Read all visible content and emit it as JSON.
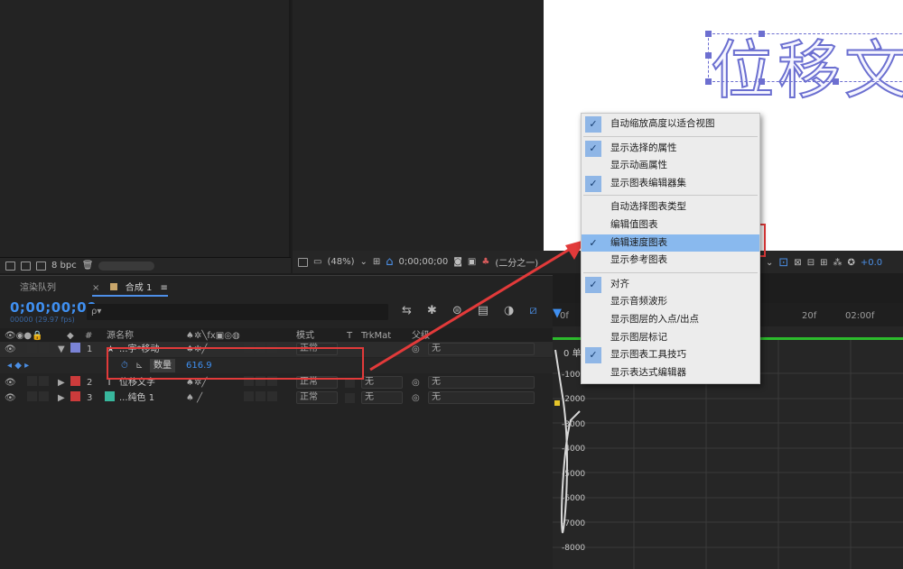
{
  "composition": {
    "title": "位移文字"
  },
  "footer_left": {
    "bpc": "8 bpc"
  },
  "viewer_toolbar": {
    "zoom": "(48%)",
    "timecode": "0;00;00;00",
    "view_mode": "(二分之一)",
    "exposure": "+0.0"
  },
  "panel": {
    "tabs": [
      {
        "label": "渲染队列",
        "close": "×"
      },
      {
        "label": "合成 1",
        "menu": "≡"
      }
    ]
  },
  "timeline": {
    "timecode": "0;00;00;00",
    "fps": "00000 (29.97 fps)",
    "search_placeholder": "ρ▾",
    "columns": {
      "num": "#",
      "source": "源名称",
      "mode": "模式",
      "t": "T",
      "trkmat": "TrkMat",
      "parent": "父级"
    },
    "layers": [
      {
        "num": "1",
        "name": "...字*移动",
        "mode": "正常",
        "trkmat": "",
        "parent": "无",
        "color": "#7a83d6"
      },
      {
        "num": "2",
        "name": "位移文字",
        "mode": "正常",
        "trkmat": "无",
        "parent": "无",
        "color": "#cc3b3b"
      },
      {
        "num": "3",
        "name": "...纯色 1",
        "mode": "正常",
        "trkmat": "无",
        "parent": "无",
        "color": "#cc3b3b"
      }
    ],
    "property": {
      "name": "数量",
      "value": "616.9"
    }
  },
  "graph": {
    "ruler_labels": [
      "0f",
      "20f",
      "02:00f"
    ],
    "unit_label": "0 单位",
    "y_labels": [
      "-1000",
      "-2000",
      "-3000",
      "-4000",
      "-5000",
      "-6000",
      "-7000",
      "-8000"
    ]
  },
  "context_menu": {
    "items": [
      {
        "label": "自动缩放高度以适合视图",
        "checked": true,
        "highlighted": false,
        "sep_after": true
      },
      {
        "label": "显示选择的属性",
        "checked": true,
        "highlighted": false,
        "sep_after": false
      },
      {
        "label": "显示动画属性",
        "checked": false,
        "highlighted": false,
        "sep_after": false
      },
      {
        "label": "显示图表编辑器集",
        "checked": true,
        "highlighted": false,
        "sep_after": true
      },
      {
        "label": "自动选择图表类型",
        "checked": false,
        "highlighted": false,
        "sep_after": false
      },
      {
        "label": "编辑值图表",
        "checked": false,
        "highlighted": false,
        "sep_after": false
      },
      {
        "label": "编辑速度图表",
        "checked": true,
        "highlighted": true,
        "sep_after": false
      },
      {
        "label": "显示参考图表",
        "checked": false,
        "highlighted": false,
        "sep_after": true
      },
      {
        "label": "对齐",
        "checked": true,
        "highlighted": false,
        "sep_after": false
      },
      {
        "label": "显示音频波形",
        "checked": false,
        "highlighted": false,
        "sep_after": false
      },
      {
        "label": "显示图层的入点/出点",
        "checked": false,
        "highlighted": false,
        "sep_after": false
      },
      {
        "label": "显示图层标记",
        "checked": false,
        "highlighted": false,
        "sep_after": false
      },
      {
        "label": "显示图表工具技巧",
        "checked": true,
        "highlighted": false,
        "sep_after": false
      },
      {
        "label": "显示表达式编辑器",
        "checked": false,
        "highlighted": false,
        "sep_after": false
      }
    ],
    "check_glyph": "✓"
  },
  "colors": {
    "accent": "#3f8ff0",
    "annotation": "#e23a3a",
    "menu_highlight": "#89b9ee",
    "graph_line": "#2cbb2c"
  }
}
